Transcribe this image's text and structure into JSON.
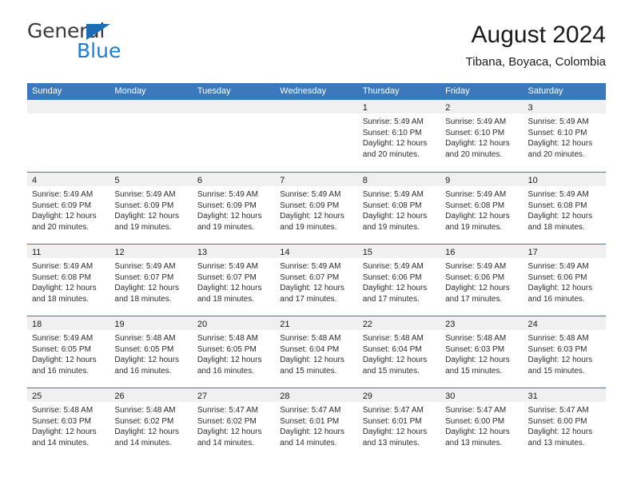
{
  "brand": {
    "name_top": "General",
    "name_bottom": "Blue",
    "accent_color": "#1a7dd1",
    "triangle_color": "#1a6cb5"
  },
  "header": {
    "title": "August 2024",
    "subtitle": "Tibana, Boyaca, Colombia"
  },
  "calendar": {
    "header_bg": "#3b79bc",
    "header_text_color": "#ffffff",
    "day_band_bg": "#f0f0f0",
    "weekdays": [
      "Sunday",
      "Monday",
      "Tuesday",
      "Wednesday",
      "Thursday",
      "Friday",
      "Saturday"
    ],
    "weeks": [
      [
        {
          "day": "",
          "sunrise": "",
          "sunset": "",
          "daylight_line1": "",
          "daylight_line2": ""
        },
        {
          "day": "",
          "sunrise": "",
          "sunset": "",
          "daylight_line1": "",
          "daylight_line2": ""
        },
        {
          "day": "",
          "sunrise": "",
          "sunset": "",
          "daylight_line1": "",
          "daylight_line2": ""
        },
        {
          "day": "",
          "sunrise": "",
          "sunset": "",
          "daylight_line1": "",
          "daylight_line2": ""
        },
        {
          "day": "1",
          "sunrise": "Sunrise: 5:49 AM",
          "sunset": "Sunset: 6:10 PM",
          "daylight_line1": "Daylight: 12 hours",
          "daylight_line2": "and 20 minutes."
        },
        {
          "day": "2",
          "sunrise": "Sunrise: 5:49 AM",
          "sunset": "Sunset: 6:10 PM",
          "daylight_line1": "Daylight: 12 hours",
          "daylight_line2": "and 20 minutes."
        },
        {
          "day": "3",
          "sunrise": "Sunrise: 5:49 AM",
          "sunset": "Sunset: 6:10 PM",
          "daylight_line1": "Daylight: 12 hours",
          "daylight_line2": "and 20 minutes."
        }
      ],
      [
        {
          "day": "4",
          "sunrise": "Sunrise: 5:49 AM",
          "sunset": "Sunset: 6:09 PM",
          "daylight_line1": "Daylight: 12 hours",
          "daylight_line2": "and 20 minutes."
        },
        {
          "day": "5",
          "sunrise": "Sunrise: 5:49 AM",
          "sunset": "Sunset: 6:09 PM",
          "daylight_line1": "Daylight: 12 hours",
          "daylight_line2": "and 19 minutes."
        },
        {
          "day": "6",
          "sunrise": "Sunrise: 5:49 AM",
          "sunset": "Sunset: 6:09 PM",
          "daylight_line1": "Daylight: 12 hours",
          "daylight_line2": "and 19 minutes."
        },
        {
          "day": "7",
          "sunrise": "Sunrise: 5:49 AM",
          "sunset": "Sunset: 6:09 PM",
          "daylight_line1": "Daylight: 12 hours",
          "daylight_line2": "and 19 minutes."
        },
        {
          "day": "8",
          "sunrise": "Sunrise: 5:49 AM",
          "sunset": "Sunset: 6:08 PM",
          "daylight_line1": "Daylight: 12 hours",
          "daylight_line2": "and 19 minutes."
        },
        {
          "day": "9",
          "sunrise": "Sunrise: 5:49 AM",
          "sunset": "Sunset: 6:08 PM",
          "daylight_line1": "Daylight: 12 hours",
          "daylight_line2": "and 19 minutes."
        },
        {
          "day": "10",
          "sunrise": "Sunrise: 5:49 AM",
          "sunset": "Sunset: 6:08 PM",
          "daylight_line1": "Daylight: 12 hours",
          "daylight_line2": "and 18 minutes."
        }
      ],
      [
        {
          "day": "11",
          "sunrise": "Sunrise: 5:49 AM",
          "sunset": "Sunset: 6:08 PM",
          "daylight_line1": "Daylight: 12 hours",
          "daylight_line2": "and 18 minutes."
        },
        {
          "day": "12",
          "sunrise": "Sunrise: 5:49 AM",
          "sunset": "Sunset: 6:07 PM",
          "daylight_line1": "Daylight: 12 hours",
          "daylight_line2": "and 18 minutes."
        },
        {
          "day": "13",
          "sunrise": "Sunrise: 5:49 AM",
          "sunset": "Sunset: 6:07 PM",
          "daylight_line1": "Daylight: 12 hours",
          "daylight_line2": "and 18 minutes."
        },
        {
          "day": "14",
          "sunrise": "Sunrise: 5:49 AM",
          "sunset": "Sunset: 6:07 PM",
          "daylight_line1": "Daylight: 12 hours",
          "daylight_line2": "and 17 minutes."
        },
        {
          "day": "15",
          "sunrise": "Sunrise: 5:49 AM",
          "sunset": "Sunset: 6:06 PM",
          "daylight_line1": "Daylight: 12 hours",
          "daylight_line2": "and 17 minutes."
        },
        {
          "day": "16",
          "sunrise": "Sunrise: 5:49 AM",
          "sunset": "Sunset: 6:06 PM",
          "daylight_line1": "Daylight: 12 hours",
          "daylight_line2": "and 17 minutes."
        },
        {
          "day": "17",
          "sunrise": "Sunrise: 5:49 AM",
          "sunset": "Sunset: 6:06 PM",
          "daylight_line1": "Daylight: 12 hours",
          "daylight_line2": "and 16 minutes."
        }
      ],
      [
        {
          "day": "18",
          "sunrise": "Sunrise: 5:49 AM",
          "sunset": "Sunset: 6:05 PM",
          "daylight_line1": "Daylight: 12 hours",
          "daylight_line2": "and 16 minutes."
        },
        {
          "day": "19",
          "sunrise": "Sunrise: 5:48 AM",
          "sunset": "Sunset: 6:05 PM",
          "daylight_line1": "Daylight: 12 hours",
          "daylight_line2": "and 16 minutes."
        },
        {
          "day": "20",
          "sunrise": "Sunrise: 5:48 AM",
          "sunset": "Sunset: 6:05 PM",
          "daylight_line1": "Daylight: 12 hours",
          "daylight_line2": "and 16 minutes."
        },
        {
          "day": "21",
          "sunrise": "Sunrise: 5:48 AM",
          "sunset": "Sunset: 6:04 PM",
          "daylight_line1": "Daylight: 12 hours",
          "daylight_line2": "and 15 minutes."
        },
        {
          "day": "22",
          "sunrise": "Sunrise: 5:48 AM",
          "sunset": "Sunset: 6:04 PM",
          "daylight_line1": "Daylight: 12 hours",
          "daylight_line2": "and 15 minutes."
        },
        {
          "day": "23",
          "sunrise": "Sunrise: 5:48 AM",
          "sunset": "Sunset: 6:03 PM",
          "daylight_line1": "Daylight: 12 hours",
          "daylight_line2": "and 15 minutes."
        },
        {
          "day": "24",
          "sunrise": "Sunrise: 5:48 AM",
          "sunset": "Sunset: 6:03 PM",
          "daylight_line1": "Daylight: 12 hours",
          "daylight_line2": "and 15 minutes."
        }
      ],
      [
        {
          "day": "25",
          "sunrise": "Sunrise: 5:48 AM",
          "sunset": "Sunset: 6:03 PM",
          "daylight_line1": "Daylight: 12 hours",
          "daylight_line2": "and 14 minutes."
        },
        {
          "day": "26",
          "sunrise": "Sunrise: 5:48 AM",
          "sunset": "Sunset: 6:02 PM",
          "daylight_line1": "Daylight: 12 hours",
          "daylight_line2": "and 14 minutes."
        },
        {
          "day": "27",
          "sunrise": "Sunrise: 5:47 AM",
          "sunset": "Sunset: 6:02 PM",
          "daylight_line1": "Daylight: 12 hours",
          "daylight_line2": "and 14 minutes."
        },
        {
          "day": "28",
          "sunrise": "Sunrise: 5:47 AM",
          "sunset": "Sunset: 6:01 PM",
          "daylight_line1": "Daylight: 12 hours",
          "daylight_line2": "and 14 minutes."
        },
        {
          "day": "29",
          "sunrise": "Sunrise: 5:47 AM",
          "sunset": "Sunset: 6:01 PM",
          "daylight_line1": "Daylight: 12 hours",
          "daylight_line2": "and 13 minutes."
        },
        {
          "day": "30",
          "sunrise": "Sunrise: 5:47 AM",
          "sunset": "Sunset: 6:00 PM",
          "daylight_line1": "Daylight: 12 hours",
          "daylight_line2": "and 13 minutes."
        },
        {
          "day": "31",
          "sunrise": "Sunrise: 5:47 AM",
          "sunset": "Sunset: 6:00 PM",
          "daylight_line1": "Daylight: 12 hours",
          "daylight_line2": "and 13 minutes."
        }
      ]
    ]
  }
}
